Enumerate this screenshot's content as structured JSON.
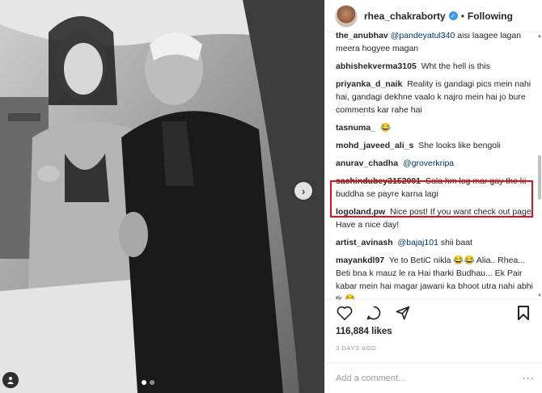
{
  "header": {
    "username": "rhea_chakraborty",
    "separator": "•",
    "follow_label": "Following"
  },
  "comments": [
    {
      "user": "the_anubhav",
      "mention": "@pandeyatul340",
      "text": "aisi laagee lagan meera hogyee magan"
    },
    {
      "user": "abhishekverma3105",
      "text": "Wht the hell is this"
    },
    {
      "user": "priyanka_d_naik",
      "text": "Reality is gandagi pics mein nahi hai, gandagi dekhne vaalo k najro mein hai jo bure comments kar rahe hai"
    },
    {
      "user": "tasnuma_",
      "text": "😂"
    },
    {
      "user": "mohd_javeed_ali_s",
      "text": "She looks like bengoli"
    },
    {
      "user": "anurav_chadha",
      "mention": "@groverkripa",
      "text": ""
    },
    {
      "user": "sachindubey3152001",
      "text": "Sala hm log mar gay the ki buddha se payre karna lagi"
    },
    {
      "user": "logoland.pw",
      "text": "Nice post! If you want check out page! Have a nice day!"
    },
    {
      "user": "artist_avinash",
      "mention": "@bajaj101",
      "text": "shii baat"
    },
    {
      "user": "mayankdl97",
      "text": "Ye to BetiC nikla 😂😂 Alia.. Rhea... Beti bna k mauz le ra Hai tharki Budhau... Ek Pair kabar mein hai magar jawani ka bhoot utra nahi abhi tk 😂"
    }
  ],
  "icons": {
    "like": "heart-icon",
    "comment": "comment-icon",
    "share": "share-icon",
    "save": "bookmark-icon",
    "verified": "verified-badge-icon",
    "tag": "user-tag-icon",
    "next": "chevron-right-icon"
  },
  "likes": "116,884 likes",
  "date": "3 DAYS AGO",
  "add_comment": {
    "placeholder": "Add a comment...",
    "more": "···"
  },
  "colors": {
    "highlight_border": "#e0101e",
    "verified": "#3897f0",
    "mention": "#003569"
  },
  "carousel": {
    "pages": 2,
    "active": 1
  }
}
